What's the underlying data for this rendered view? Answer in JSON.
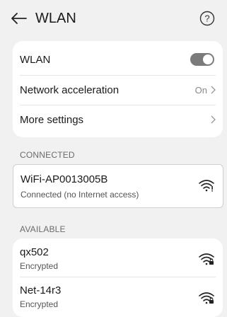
{
  "header": {
    "title": "WLAN",
    "back_icon": "back-arrow-icon",
    "help_icon": "help-icon"
  },
  "settings": {
    "wlan_label": "WLAN",
    "wlan_enabled": true,
    "acceleration_label": "Network acceleration",
    "acceleration_value": "On",
    "more_label": "More settings"
  },
  "connected": {
    "section_title": "CONNECTED",
    "network": {
      "name": "WiFi-AP0013005B",
      "status": "Connected (no Internet access)",
      "icon": "wifi-no-internet-icon"
    }
  },
  "available": {
    "section_title": "AVAILABLE",
    "networks": [
      {
        "name": "qx502",
        "security": "Encrypted",
        "icon": "wifi-locked-icon"
      },
      {
        "name": "Net-14r3",
        "security": "Encrypted",
        "icon": "wifi-locked-icon"
      }
    ]
  },
  "colors": {
    "background": "#f1f1f1",
    "card": "#ffffff",
    "toggle_on": "#7b7b7b",
    "muted_text": "#888888"
  }
}
